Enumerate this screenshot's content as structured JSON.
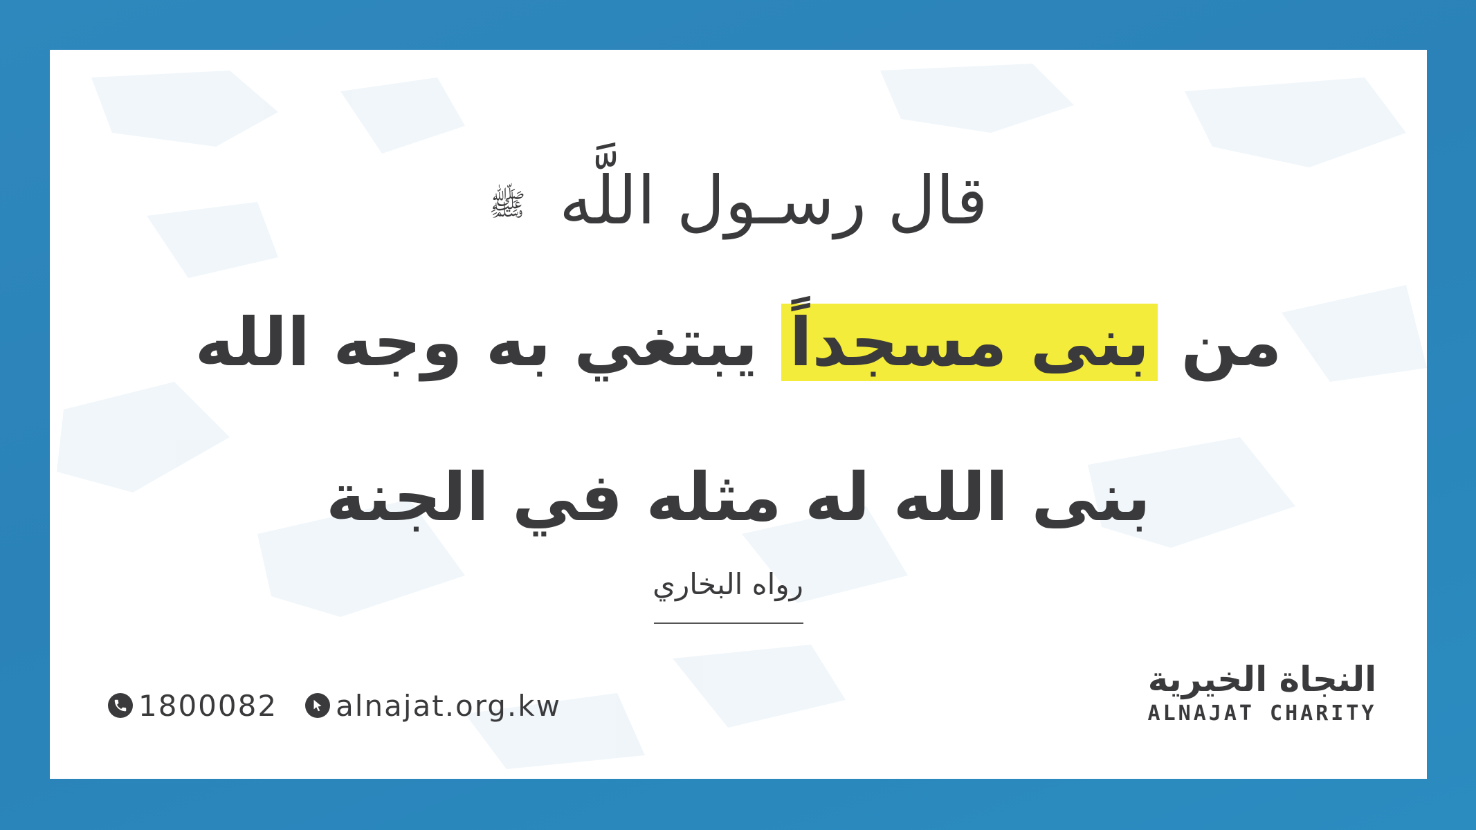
{
  "intro": {
    "text": "قال رسـول اللَّه",
    "honorific": "ﷺ"
  },
  "hadith": {
    "line1_prefix": "من",
    "line1_highlight": "بنى مسجداً",
    "line1_suffix": "يبتغي به وجه الله",
    "line2": "بنى الله له مثله في الجنة"
  },
  "source": {
    "text": "رواه البخاري"
  },
  "contact": {
    "phone": "1800082",
    "website": "alnajat.org.kw",
    "phone_icon": "phone-icon",
    "website_icon": "cursor-icon"
  },
  "logo": {
    "arabic": "النجاة الخيرية",
    "english": "ALNAJAT CHARITY"
  },
  "colors": {
    "background": "#2a82b8",
    "card": "#ffffff",
    "text": "#3a3a3c",
    "highlight": "#f4ec3a"
  }
}
